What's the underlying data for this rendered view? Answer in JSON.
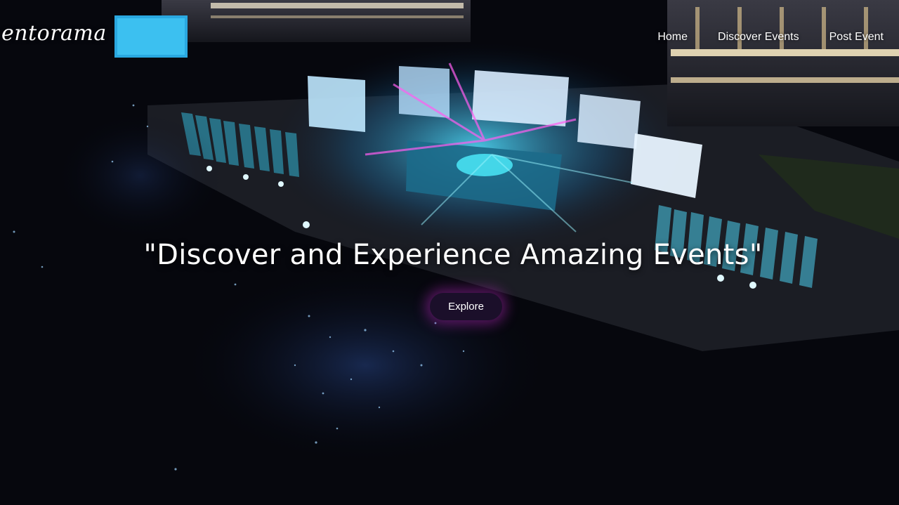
{
  "brand": {
    "name": "entorama"
  },
  "nav": {
    "items": [
      {
        "label": "Home"
      },
      {
        "label": "Discover Events"
      },
      {
        "label": "Post Event"
      }
    ]
  },
  "hero": {
    "headline": "\"Discover and Experience Amazing Events\"",
    "cta_label": "Explore"
  },
  "colors": {
    "cta_bg": "#1b0f2a",
    "cta_glow": "#be28c8",
    "stage_cyan": "#38c8f0",
    "stage_magenta": "#e048d8"
  }
}
